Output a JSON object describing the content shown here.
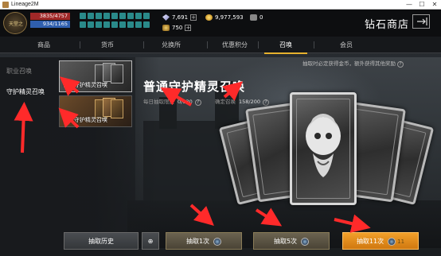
{
  "window": {
    "title": "Lineage2M",
    "minimize": "—",
    "maximize": "☐",
    "close": "✕"
  },
  "hud": {
    "avatar_label": "天堂之",
    "hp": "3835/4757",
    "mp": "934/1165",
    "diamonds": "7,691",
    "gold": "9,977,593",
    "red_gem": "750",
    "bag_count": "0",
    "shop_title": "钻石商店"
  },
  "tabs": [
    {
      "label": "商品",
      "active": false
    },
    {
      "label": "货币",
      "active": false
    },
    {
      "label": "兑换所",
      "active": false
    },
    {
      "label": "优惠积分",
      "active": false
    },
    {
      "label": "召唤",
      "active": true
    },
    {
      "label": "会员",
      "active": false
    }
  ],
  "notice": {
    "text": "抽取时必定获得金币，额外获得其他奖励",
    "help": "?"
  },
  "side_menu": [
    {
      "label": "职业召唤",
      "active": false
    },
    {
      "label": "守护精灵召唤",
      "active": true
    }
  ],
  "summon_options": [
    {
      "label": "普通守护精灵召唤",
      "selected": true
    },
    {
      "label": "高级守护精灵召唤",
      "selected": false
    }
  ],
  "main": {
    "title": "普通守护精灵召唤",
    "daily_label": "每日抽取限度",
    "daily_value": "0/330",
    "guarantee_label": "确定召唤",
    "guarantee_value": "158/200",
    "help": "?"
  },
  "buttons": {
    "history": "抽取历史",
    "zoom": "⊕",
    "pull_1": "抽取1次",
    "pull_5": "抽取5次",
    "pull_11": "抽取11次",
    "pull_11_cost": "11"
  },
  "colors": {
    "accent": "#e6b12e",
    "pull_primary": "#f2a02a",
    "annotation_arrow": "#ff2a2a"
  }
}
